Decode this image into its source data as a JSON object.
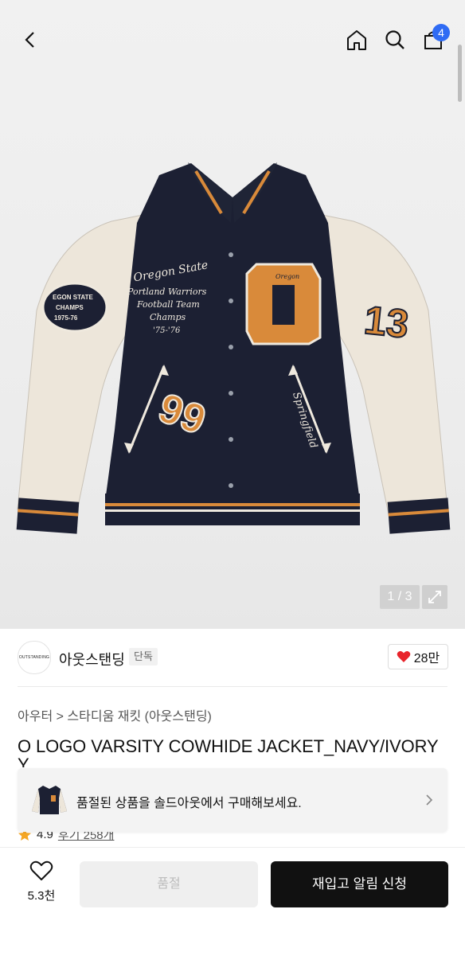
{
  "header": {
    "cart_count": "4"
  },
  "gallery": {
    "pager": "1 / 3",
    "jacket_patch_text": [
      "Oregon State",
      "Portland Warriors",
      "Football Team",
      "Champs",
      "'75-'76"
    ],
    "sleeve_patch_text": [
      "EGON STATE",
      "CHAMPS",
      "1975-76"
    ],
    "numbers": [
      "O",
      "99",
      "13"
    ],
    "script_text": "Springfield"
  },
  "brand": {
    "logo_text": "OUTSTANDING",
    "name": "아웃스탠딩",
    "tag": "단독",
    "like_count": "28만"
  },
  "product": {
    "breadcrumb_root": "아우터",
    "breadcrumb_sep": ">",
    "breadcrumb_leaf": "스타디움 재킷 (아웃스탠딩)",
    "title": "O LOGO VARSITY COWHIDE JACKET_NAVY/IVORY",
    "title_overflow": "Y",
    "rating": "4.9",
    "reviews": "후기 258개"
  },
  "toast": {
    "message": "품절된 상품을 솔드아웃에서 구매해보세요."
  },
  "bottom_bar": {
    "heart_count": "5.3천",
    "soldout_label": "품절",
    "restock_label": "재입고 알림 신청"
  },
  "colors": {
    "navy": "#1c2033",
    "ivory": "#efe9de",
    "orange": "#d98a3a",
    "badge_blue": "#2f6bf4",
    "like_red": "#e8242b"
  }
}
